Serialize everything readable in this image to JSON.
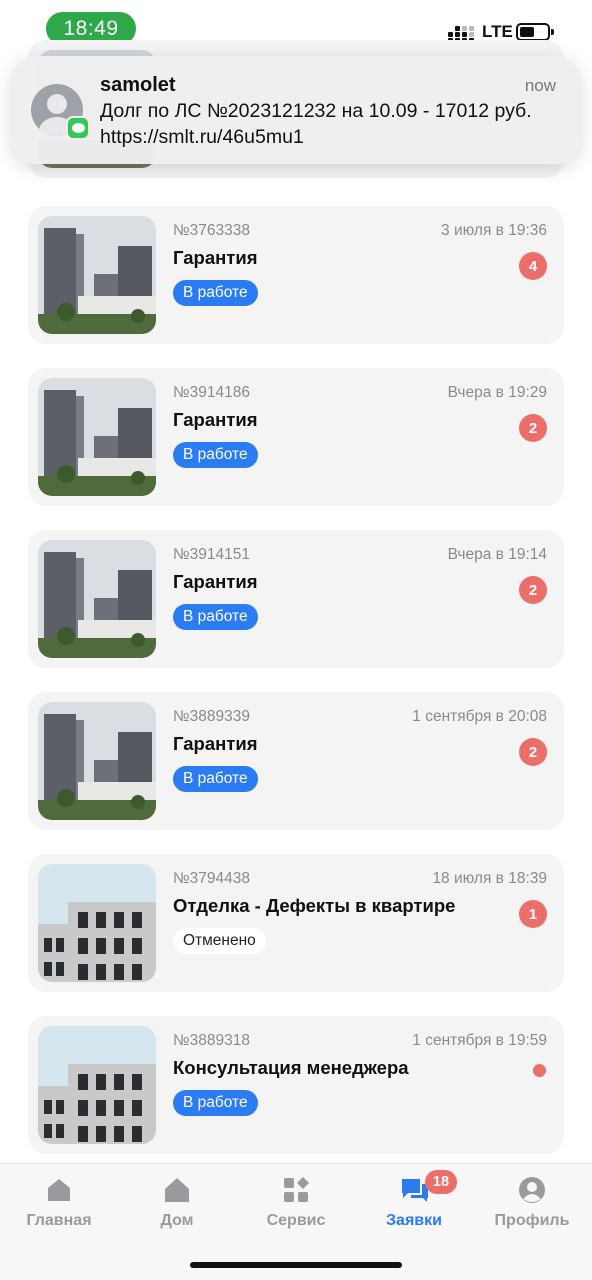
{
  "status_bar": {
    "time": "18:49",
    "network": "LTE"
  },
  "notification": {
    "app": "samolet",
    "when": "now",
    "text": "Долг по ЛС №2023121232 на 10.09 - 17012 руб. https://smlt.ru/46u5mu1"
  },
  "requests": [
    {
      "number": "№3763338",
      "date": "3 июля в 19:36",
      "title": "Гарантия",
      "status": "В работе",
      "status_kind": "active",
      "unread": "4",
      "thumb": "towers"
    },
    {
      "number": "№3914186",
      "date": "Вчера в 19:29",
      "title": "Гарантия",
      "status": "В работе",
      "status_kind": "active",
      "unread": "2",
      "thumb": "towers"
    },
    {
      "number": "№3914151",
      "date": "Вчера в 19:14",
      "title": "Гарантия",
      "status": "В работе",
      "status_kind": "active",
      "unread": "2",
      "thumb": "towers"
    },
    {
      "number": "№3889339",
      "date": "1 сентября в 20:08",
      "title": "Гарантия",
      "status": "В работе",
      "status_kind": "active",
      "unread": "2",
      "thumb": "towers"
    },
    {
      "number": "№3794438",
      "date": "18 июля в 18:39",
      "title": "Отделка - Дефекты в квартире",
      "status": "Отменено",
      "status_kind": "cancelled",
      "unread": "1",
      "thumb": "facade"
    },
    {
      "number": "№3889318",
      "date": "1 сентября в 19:59",
      "title": "Консультация менеджера",
      "status": "В работе",
      "status_kind": "active",
      "unread": "",
      "thumb": "facade"
    }
  ],
  "tabbar": {
    "items": [
      {
        "label": "Главная",
        "icon": "home-icon",
        "active": false
      },
      {
        "label": "Дом",
        "icon": "house-icon",
        "active": false
      },
      {
        "label": "Сервис",
        "icon": "grid-icon",
        "active": false
      },
      {
        "label": "Заявки",
        "icon": "chat-icon",
        "active": true
      },
      {
        "label": "Профиль",
        "icon": "profile-icon",
        "active": false
      }
    ],
    "requests_badge": "18"
  },
  "colors": {
    "accent": "#2b7bf2",
    "badge": "#eb6e6a",
    "status_time": "#2ea84a"
  }
}
